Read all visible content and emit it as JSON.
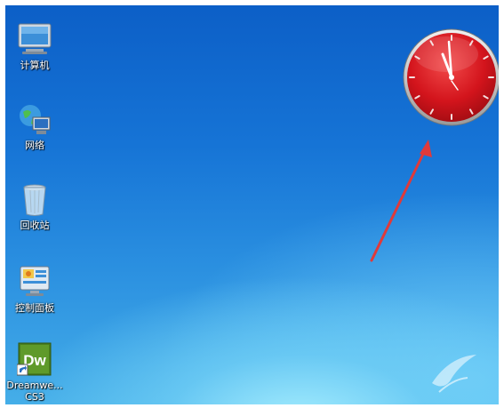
{
  "desktop": {
    "icons": [
      {
        "name": "computer",
        "label": "计算机",
        "icon": "computer-icon"
      },
      {
        "name": "network",
        "label": "网络",
        "icon": "network-icon"
      },
      {
        "name": "recycle-bin",
        "label": "回收站",
        "icon": "recycle-bin-icon"
      },
      {
        "name": "control-panel",
        "label": "控制面板",
        "icon": "control-panel-icon"
      },
      {
        "name": "dreamweaver",
        "label": "Dreamwe...",
        "label2": "CS3",
        "icon": "dreamweaver-icon",
        "badge": "Dw"
      }
    ]
  },
  "gadget": {
    "type": "clock",
    "time": "11:59",
    "face_color": "#d3141c"
  },
  "annotation": {
    "type": "arrow",
    "color": "#e03a3a"
  },
  "colors": {
    "desktop_top": "#0c5fc7",
    "desktop_bottom": "#45aee8"
  }
}
